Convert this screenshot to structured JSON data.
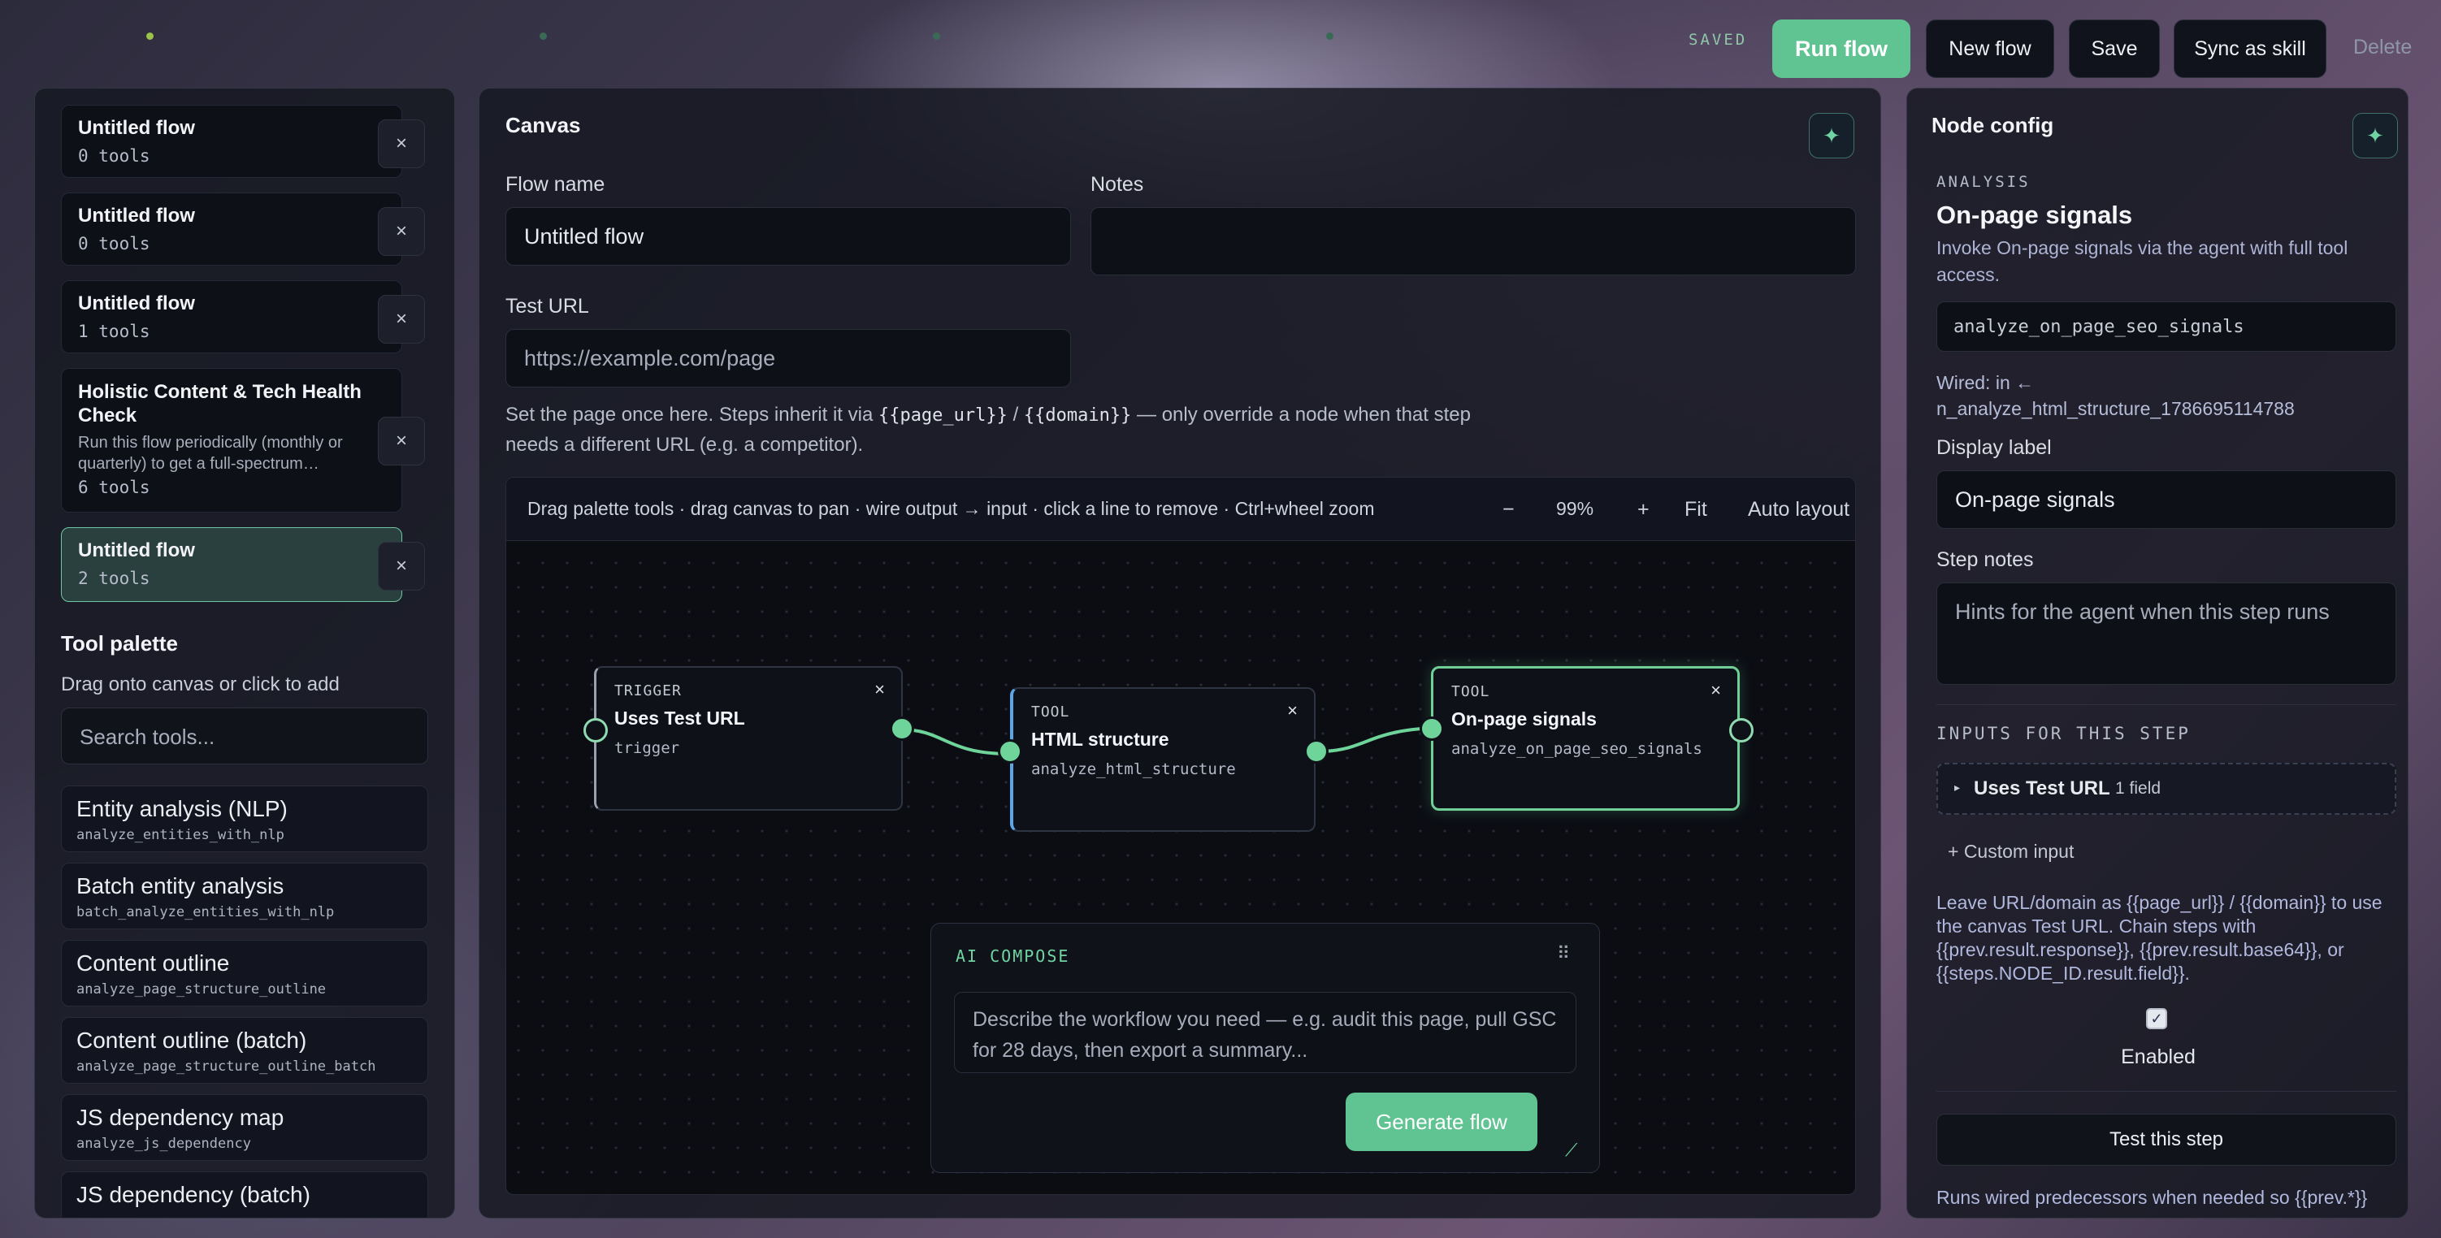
{
  "topbar": {
    "status": "SAVED",
    "run": "Run flow",
    "new": "New flow",
    "save": "Save",
    "sync": "Sync as skill",
    "delete": "Delete"
  },
  "flows": [
    {
      "title": "Untitled flow",
      "sub": "0 tools"
    },
    {
      "title": "Untitled flow",
      "sub": "0 tools"
    },
    {
      "title": "Untitled flow",
      "sub": "1 tools"
    },
    {
      "title": "Holistic Content & Tech Health Check",
      "desc": "Run this flow periodically (monthly or quarterly) to get a full-spectrum…",
      "sub": "6 tools"
    },
    {
      "title": "Untitled flow",
      "sub": "2 tools"
    }
  ],
  "palette": {
    "title": "Tool palette",
    "hint": "Drag onto canvas or click to add",
    "search_placeholder": "Search tools...",
    "tools": [
      {
        "name": "Entity analysis (NLP)",
        "fn": "analyze_entities_with_nlp"
      },
      {
        "name": "Batch entity analysis",
        "fn": "batch_analyze_entities_with_nlp"
      },
      {
        "name": "Content outline",
        "fn": "analyze_page_structure_outline"
      },
      {
        "name": "Content outline (batch)",
        "fn": "analyze_page_structure_outline_batch"
      },
      {
        "name": "JS dependency map",
        "fn": "analyze_js_dependency"
      },
      {
        "name": "JS dependency (batch)",
        "fn": ""
      }
    ]
  },
  "canvas": {
    "title": "Canvas",
    "flow_name_label": "Flow name",
    "flow_name": "Untitled flow",
    "notes_label": "Notes",
    "notes": "",
    "test_url_label": "Test URL",
    "test_url_placeholder": "https://example.com/page",
    "hint_a": "Set the page once here. Steps inherit it via ",
    "hint_code1": "{{page_url}}",
    "hint_sep": " / ",
    "hint_code2": "{{domain}}",
    "hint_b": " — only override a node when that step needs a different URL (e.g. a competitor).",
    "toolbar_hint": "Drag palette tools · drag canvas to pan · wire output → input · click a line to remove · Ctrl+wheel zoom",
    "zoom_out": "−",
    "zoom": "99%",
    "zoom_in": "+",
    "fit": "Fit",
    "auto": "Auto layout",
    "nodes": [
      {
        "kind": "TRIGGER",
        "title": "Uses Test URL",
        "fn": "trigger",
        "close": "×"
      },
      {
        "kind": "TOOL",
        "title": "HTML structure",
        "fn": "analyze_html_structure",
        "close": "×"
      },
      {
        "kind": "TOOL",
        "title": "On-page signals",
        "fn": "analyze_on_page_seo_signals",
        "close": "×"
      }
    ],
    "compose": {
      "title": "AI COMPOSE",
      "placeholder": "Describe the workflow you need — e.g. audit this page, pull GSC for 28 days, then export a summary...",
      "button": "Generate flow"
    }
  },
  "config": {
    "title": "Node config",
    "kind": "ANALYSIS",
    "name": "On-page signals",
    "desc": "Invoke On-page signals via the agent with full tool access.",
    "fn": "analyze_on_page_seo_signals",
    "wired_a": "Wired: in ←",
    "wired_b": "n_analyze_html_structure_1786695114788",
    "label_label": "Display label",
    "label": "On-page signals",
    "notes_label": "Step notes",
    "notes_placeholder": "Hints for the agent when this step runs",
    "inputs_title": "INPUTS FOR THIS STEP",
    "input_name": "Uses Test URL",
    "input_count": "1 field",
    "custom": "+ Custom input",
    "help": "Leave URL/domain as {{page_url}} / {{domain}} to use the canvas Test URL. Chain steps with {{prev.result.response}}, {{prev.result.base64}}, or {{steps.NODE_ID.result.field}}.",
    "enabled": "Enabled",
    "test": "Test this step",
    "footer": "Runs wired predecessors when needed so {{prev.*}}"
  },
  "colors": {
    "accent": "#5fc392",
    "trigger_border": "#9aa0ad",
    "tool_border": "#5aa6e6",
    "selected_border": "#6fcf97"
  }
}
